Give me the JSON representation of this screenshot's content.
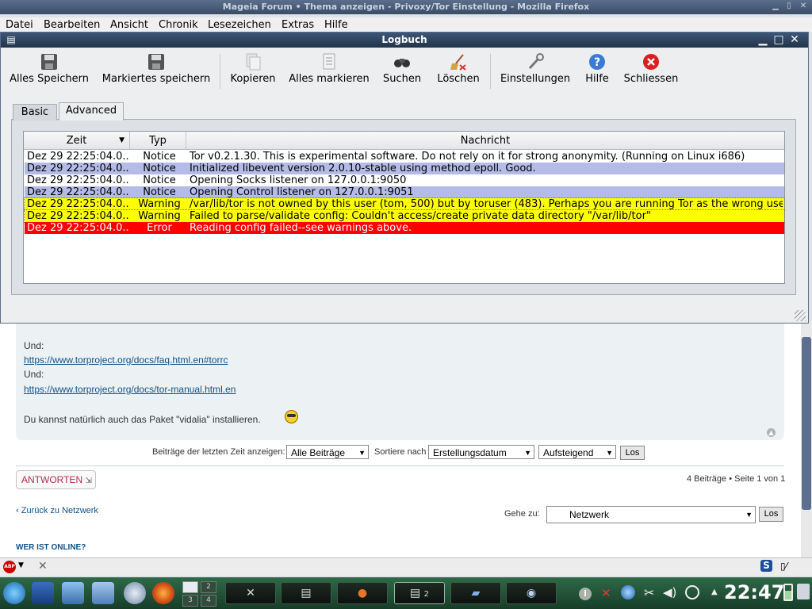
{
  "firefox": {
    "title": "Mageia Forum • Thema anzeigen - Privoxy/Tor Einstellung - Mozilla Firefox",
    "menu": [
      "Datei",
      "Bearbeiten",
      "Ansicht",
      "Chronik",
      "Lesezeichen",
      "Extras",
      "Hilfe"
    ]
  },
  "dialog": {
    "title": "Logbuch",
    "toolbar": [
      {
        "label": "Alles Speichern",
        "icon": "floppy-disk-icon"
      },
      {
        "label": "Markiertes speichern",
        "icon": "floppy-disk-icon"
      },
      {
        "label": "Kopieren",
        "icon": "copy-icon"
      },
      {
        "label": "Alles markieren",
        "icon": "select-all-icon"
      },
      {
        "label": "Suchen",
        "icon": "binoculars-icon"
      },
      {
        "label": "Löschen",
        "icon": "broom-icon"
      },
      {
        "label": "Einstellungen",
        "icon": "wrench-icon"
      },
      {
        "label": "Hilfe",
        "icon": "help-icon"
      },
      {
        "label": "Schliessen",
        "icon": "close-circle-icon"
      }
    ],
    "tabs": [
      "Basic",
      "Advanced"
    ],
    "active_tab": "Advanced",
    "columns": [
      "Zeit",
      "Typ",
      "Nachricht"
    ],
    "rows": [
      {
        "time": "Dez 29 22:25:04.0...",
        "type": "Notice",
        "message": "Tor v0.2.1.30. This is experimental software. Do not rely on it for strong anonymity. (Running on Linux i686)",
        "bg": "#ffffff",
        "fg": "#000000"
      },
      {
        "time": "Dez 29 22:25:04.0...",
        "type": "Notice",
        "message": "Initialized libevent version 2.0.10-stable using method epoll. Good.",
        "bg": "#b4bbe6",
        "fg": "#000000"
      },
      {
        "time": "Dez 29 22:25:04.0...",
        "type": "Notice",
        "message": "Opening Socks listener on 127.0.0.1:9050",
        "bg": "#ffffff",
        "fg": "#000000"
      },
      {
        "time": "Dez 29 22:25:04.0...",
        "type": "Notice",
        "message": "Opening Control listener on 127.0.0.1:9051",
        "bg": "#b4bbe6",
        "fg": "#000000"
      },
      {
        "time": "Dez 29 22:25:04.0...",
        "type": "Warning",
        "message": "/var/lib/tor is not owned by this user (tom, 500) but by toruser (483). Perhaps you are running Tor as the wrong user?",
        "bg": "#ffff00",
        "fg": "#000000"
      },
      {
        "time": "Dez 29 22:25:04.0...",
        "type": "Warning",
        "message": "Failed to parse/validate config: Couldn't access/create private data directory \"/var/lib/tor\"",
        "bg": "#ffff00",
        "fg": "#000000"
      },
      {
        "time": "Dez 29 22:25:04.0...",
        "type": "Error",
        "message": "Reading config failed--see warnings above.",
        "bg": "#ff0000",
        "fg": "#ffffff"
      }
    ]
  },
  "forum": {
    "und1": "Und:",
    "link1": "https://www.torproject.org/docs/faq.html.en#torrc",
    "und2": "Und:",
    "link2": "https://www.torproject.org/docs/tor-manual.html.en",
    "vidalia_text": "Du kannst natürlich auch das Paket \"vidalia\" installieren.",
    "filter_label": "Beiträge der letzten Zeit anzeigen:",
    "filter_value": "Alle Beiträge",
    "sort_label": "Sortiere nach",
    "sort_value": "Erstellungsdatum",
    "order_value": "Aufsteigend",
    "go_button": "Los",
    "reply_button": "ANTWORTEN",
    "pagination": "4 Beiträge • Seite 1 von 1",
    "back_link": "Zurück zu Netzwerk",
    "jump_label": "Gehe zu:",
    "jump_value": "Netzwerk",
    "jump_button": "Los",
    "who_online": "WER IST ONLINE?"
  },
  "taskbar": {
    "clock": "22:47",
    "desktops": [
      "1",
      "2",
      "3",
      "4"
    ],
    "active_task_number": "2"
  }
}
